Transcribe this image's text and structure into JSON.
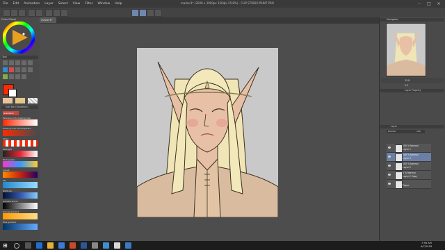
{
  "menu": {
    "items": [
      "File",
      "Edit",
      "Animation",
      "Layer",
      "Select",
      "View",
      "Filter",
      "Window",
      "Help"
    ]
  },
  "window": {
    "title": "master1* (2000 x 3000px 350dpi 25.8%) - CLIP STUDIO PAINT PRO"
  },
  "document": {
    "tab_label": "master1*"
  },
  "left_panel": {
    "color_wheel_label": "Color Wheel",
    "tool_label": "Tool",
    "sub_tool_label": "Sub Tool (Gradation)",
    "gradient_header": "Gradation",
    "gradients": [
      "Background to drawing color",
      "Drawing color to transparent",
      "Stripe",
      "Backlight",
      "Photographs",
      "Sunset",
      "Sky",
      "Night sky",
      "Gradient shade",
      "Orange gradient",
      "Blue gradient"
    ]
  },
  "right_panel": {
    "navigator_label": "Navigator",
    "zoom": "25.8",
    "rotation": "0.0",
    "layer_property_label": "Layer Property",
    "layer_tab": "Layer",
    "blend_mode": "Normal",
    "opacity": "100",
    "layers": [
      {
        "line1": "100 % Normal",
        "line2": "Layer 1",
        "selected": false
      },
      {
        "line1": "100 % Normal",
        "line2": "Layer 3",
        "selected": true
      },
      {
        "line1": "100 % Normal",
        "line2": "Layer 2",
        "selected": false
      },
      {
        "line1": "0 % Normal",
        "line2": "Layer 2 Copy",
        "selected": false
      },
      {
        "line1": "",
        "line2": "Paper",
        "selected": false
      }
    ]
  },
  "taskbar": {
    "time": "7:56 AM",
    "date": "4/7/2018"
  },
  "colors": {
    "main_color": "#ff2a00",
    "accent_selected_layer": "#6a7fa3",
    "skin": "#e8bfa8",
    "hair": "#f0e6b4"
  }
}
